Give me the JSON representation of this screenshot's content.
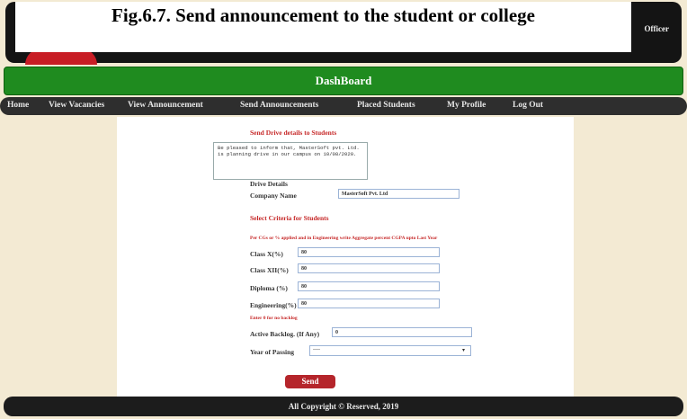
{
  "caption": "Fig.6.7. Send announcement to the student or college",
  "header": {
    "officer_text": "Officer"
  },
  "dashboard": {
    "title": "DashBoard"
  },
  "nav": {
    "items": [
      "Home",
      "View Vacancies",
      "View Announcement",
      "Send Announcements",
      "Placed Students",
      "My Profile",
      "Log Out"
    ]
  },
  "form": {
    "section_title": "Send Drive details to Students",
    "message": "Be pleased to inform that, MasterSoft pvt. Ltd. is planning drive in our campus on 10/08/2020.",
    "drive_details_label": "Drive Details",
    "company_label": "Company Name",
    "company_value": "MasterSoft Pvt. Ltd",
    "criteria_title": "Select Criteria for Students",
    "criteria_note": "Per CGs or % applied and in Engineering write Aggregate percent CGPA upto Last Year",
    "fields": [
      {
        "label": "Class X(%)",
        "value": "80"
      },
      {
        "label": "Class XII(%)",
        "value": "80"
      },
      {
        "label": "Diploma (%)",
        "value": "80"
      },
      {
        "label": "Engineering(%)",
        "value": "80"
      }
    ],
    "backlog_note": "Enter 0 for no backlog",
    "backlog_label": "Active Backlog. (If Any)",
    "backlog_value": "0",
    "year_label": "Year of Passing",
    "year_value": "----",
    "send_label": "Send"
  },
  "footer": {
    "text": "All Copyright © Reserved, 2019"
  },
  "colors": {
    "green_bar": "#1f8b1f",
    "dark_bar": "#2e2e2e",
    "accent_red": "#c62828",
    "background": "#f3ead3"
  }
}
